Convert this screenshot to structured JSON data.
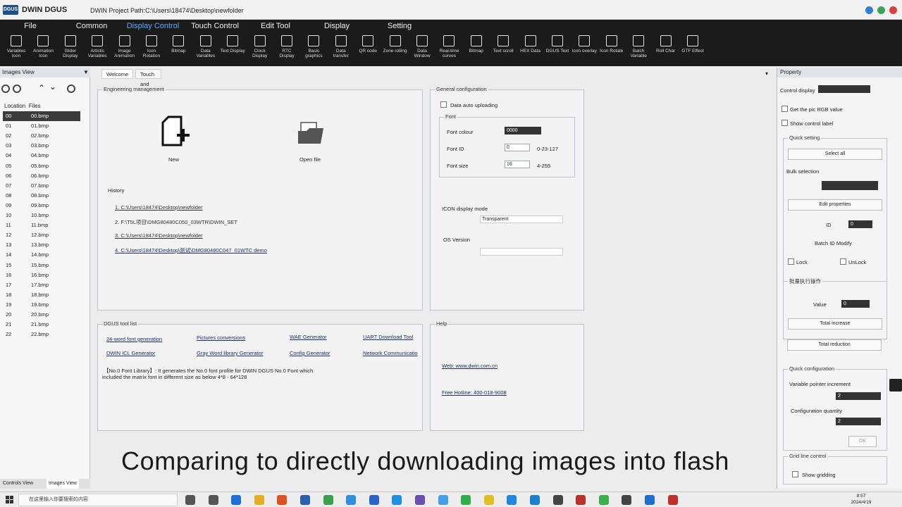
{
  "app": {
    "logo_text": "DGUS",
    "title": "DWIN DGUS",
    "project_path": "DWIN Project Path:C:\\Users\\18474\\Desktop\\newfolder"
  },
  "menu": {
    "tabs": [
      "File",
      "Common",
      "Display Control",
      "Touch Control",
      "Edit Tool",
      "Display",
      "Setting"
    ],
    "active": "Display Control"
  },
  "toolbar": {
    "tools": [
      {
        "label": "Variables Icon"
      },
      {
        "label": "Animation Icon"
      },
      {
        "label": "Slider Display"
      },
      {
        "label": "Artistic Variables"
      },
      {
        "label": "Image Animation"
      },
      {
        "label": "Icon Rotation"
      },
      {
        "label": "Bitmap"
      },
      {
        "label": "Data Variables"
      },
      {
        "label": "Text Display"
      },
      {
        "label": "Clock Display"
      },
      {
        "label": "RTC Display"
      },
      {
        "label": "Basic graphics"
      },
      {
        "label": "Data transfer"
      },
      {
        "label": "QR code"
      },
      {
        "label": "Zone rolling"
      },
      {
        "label": "Data Window"
      },
      {
        "label": "Real-time curves"
      },
      {
        "label": "Bitmap"
      },
      {
        "label": "Text scroll"
      },
      {
        "label": "HEX Data"
      },
      {
        "label": "DGUS Text"
      },
      {
        "label": "Icon overlay"
      },
      {
        "label": "Icon Rotate"
      },
      {
        "label": "Batch Variable"
      },
      {
        "label": "Roll Char"
      },
      {
        "label": "GTF Effect"
      }
    ]
  },
  "left_panel": {
    "title": "Images View",
    "columns": [
      "Location",
      "Files"
    ],
    "files": [
      {
        "loc": "00",
        "name": "00.bmp"
      },
      {
        "loc": "01",
        "name": "01.bmp"
      },
      {
        "loc": "02",
        "name": "02.bmp"
      },
      {
        "loc": "03",
        "name": "03.bmp"
      },
      {
        "loc": "04",
        "name": "04.bmp"
      },
      {
        "loc": "05",
        "name": "05.bmp"
      },
      {
        "loc": "06",
        "name": "06.bmp"
      },
      {
        "loc": "07",
        "name": "07.bmp"
      },
      {
        "loc": "08",
        "name": "08.bmp"
      },
      {
        "loc": "09",
        "name": "09.bmp"
      },
      {
        "loc": "10",
        "name": "10.bmp"
      },
      {
        "loc": "11",
        "name": "11.bmp"
      },
      {
        "loc": "12",
        "name": "12.bmp"
      },
      {
        "loc": "13",
        "name": "13.bmp"
      },
      {
        "loc": "14",
        "name": "14.bmp"
      },
      {
        "loc": "15",
        "name": "15.bmp"
      },
      {
        "loc": "16",
        "name": "16.bmp"
      },
      {
        "loc": "17",
        "name": "17.bmp"
      },
      {
        "loc": "18",
        "name": "18.bmp"
      },
      {
        "loc": "19",
        "name": "19.bmp"
      },
      {
        "loc": "20",
        "name": "20.bmp"
      },
      {
        "loc": "21",
        "name": "21.bmp"
      },
      {
        "loc": "22",
        "name": "22.bmp"
      }
    ],
    "bottom_tabs": [
      "Controls View",
      "Images View"
    ]
  },
  "doc_tabs": [
    "Welcome",
    "Touch and display config"
  ],
  "engineering": {
    "title": "Engineering management",
    "new_label": "New",
    "open_label": "Open file",
    "history_title": "History",
    "history": [
      "1. C:\\Users\\18474\\Desktop\\newfolder",
      "2. F:\\T5L项目\\DMG80480C050_03WTR\\DWIN_SET",
      "3. C:\\Users\\18474\\Desktop\\newfolder",
      "4. C:\\Users\\18474\\Desktop\\测试\\DMG80480C047_01WTC demo"
    ]
  },
  "general": {
    "title": "General configuration",
    "auto_upload": "Data auto uploading",
    "font_group": "Font",
    "font_colour_label": "Font colour",
    "font_colour_value": "0000",
    "font_id_label": "Font ID",
    "font_id_value": "0",
    "font_id_range": "0-23-127",
    "font_size_label": "Font size",
    "font_size_value": "16",
    "font_size_range": "4-255",
    "icon_mode_label": "ICON display mode",
    "icon_mode_value": "Transparent",
    "os_version_label": "OS Version",
    "os_version_value": ""
  },
  "dgus_tools": {
    "title": "DGUS tool list",
    "links": [
      "24-word font generation",
      "Pictures conversions",
      "WAE Generator",
      "UART Download Tool",
      "DWIN ICL Generator",
      "Gray Word library Generator",
      "Config Generator",
      "Network Communicatio"
    ],
    "note_line1": "【No.0 Font Library】: It generates the No.0 font profile for DWIN DGUS No.0 Font which",
    "note_line2": "included the matrix font in different size as below 4*8 - 64*128"
  },
  "help": {
    "title": "Help",
    "web": "Web: www.dwin.com.cn",
    "hotline": "Free Hotline: 400-018-9008"
  },
  "property": {
    "title": "Property",
    "control_display_label": "Control display",
    "get_rgb_label": "Get the pic RGB value",
    "show_label_label": "Show control label",
    "quick_setting": "Quick setting",
    "select_all": "Select all",
    "bulk_selection": "Bulk selection",
    "edit_properties": "Edit properties",
    "id_label": "ID",
    "id_value": "0",
    "batch_id": "Batch ID Modify",
    "lock": "Lock",
    "unlock": "UnLock",
    "group_title": "批量执行操作",
    "value_label": "Value",
    "value_value": "0",
    "total_increase": "Total increase",
    "total_reduction": "Total reduction",
    "quick_config": "Quick configuration",
    "var_pointer": "Variable pointer increment",
    "var_pointer_value": "2",
    "config_qty": "Configuration quantity",
    "config_qty_value": "2",
    "ok": "OK",
    "grid_title": "Grid line control",
    "show_grid": "Show gridding"
  },
  "caption": "Comparing to directly downloading images into flash",
  "taskbar": {
    "search_placeholder": "在这里输入你要搜索的内容",
    "time": "8:57",
    "date": "2024/4/19"
  },
  "colors": {
    "menu_bg": "#1b1b1b",
    "accent": "#5aa9ff",
    "selected_row": "#3b3b3b"
  }
}
